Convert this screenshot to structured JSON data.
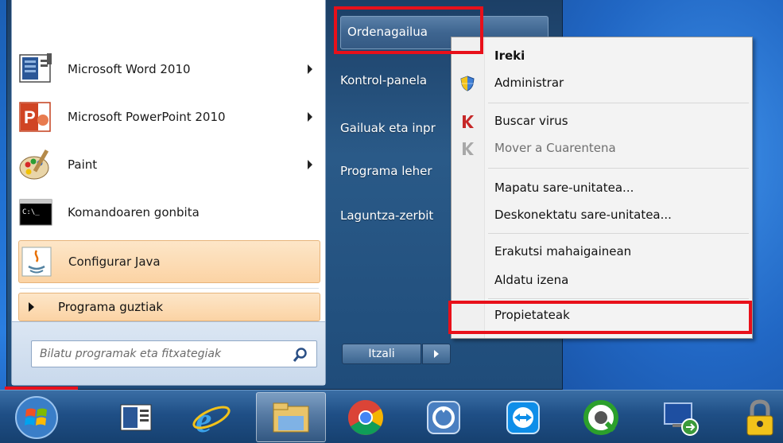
{
  "start_menu": {
    "programs": [
      {
        "label": "Microsoft Word 2010",
        "icon": "word-icon",
        "has_submenu": true
      },
      {
        "label": "Microsoft PowerPoint 2010",
        "icon": "powerpoint-icon",
        "has_submenu": true
      },
      {
        "label": "Paint",
        "icon": "paint-icon",
        "has_submenu": true
      },
      {
        "label": "Komandoaren gonbita",
        "icon": "cmd-icon",
        "has_submenu": false
      },
      {
        "label": "Configurar Java",
        "icon": "java-icon",
        "has_submenu": false
      }
    ],
    "all_programs_label": "Programa guztiak",
    "search_placeholder": "Bilatu programak eta fitxategiak",
    "right_items": {
      "computer": "Ordenagailua",
      "control_panel": "Kontrol-panela",
      "devices": "Gailuak eta inpr",
      "default_programs": "Programa leher",
      "help": "Laguntza-zerbit"
    },
    "shutdown_label": "Itzali"
  },
  "context_menu": {
    "open": "Ireki",
    "manage": "Administrar",
    "scan": "Buscar virus",
    "quarantine": "Mover a Cuarentena",
    "map_drive": "Mapatu sare-unitatea...",
    "disconnect_drive": "Deskonektatu sare-unitatea...",
    "show_desktop": "Erakutsi mahaigainean",
    "rename": "Aldatu izena",
    "properties": "Propietateak"
  },
  "taskbar": {
    "icons": [
      "windows-start-icon",
      "media-center-icon",
      "internet-explorer-icon",
      "file-explorer-icon",
      "chrome-icon",
      "recycle-app-icon",
      "teamviewer-icon",
      "qlik-icon",
      "remote-desktop-icon",
      "lock-icon"
    ]
  },
  "colors": {
    "highlight_red": "#e8101a",
    "menu_hover": "#fbd3a4",
    "taskbar": "#1f4f86"
  }
}
